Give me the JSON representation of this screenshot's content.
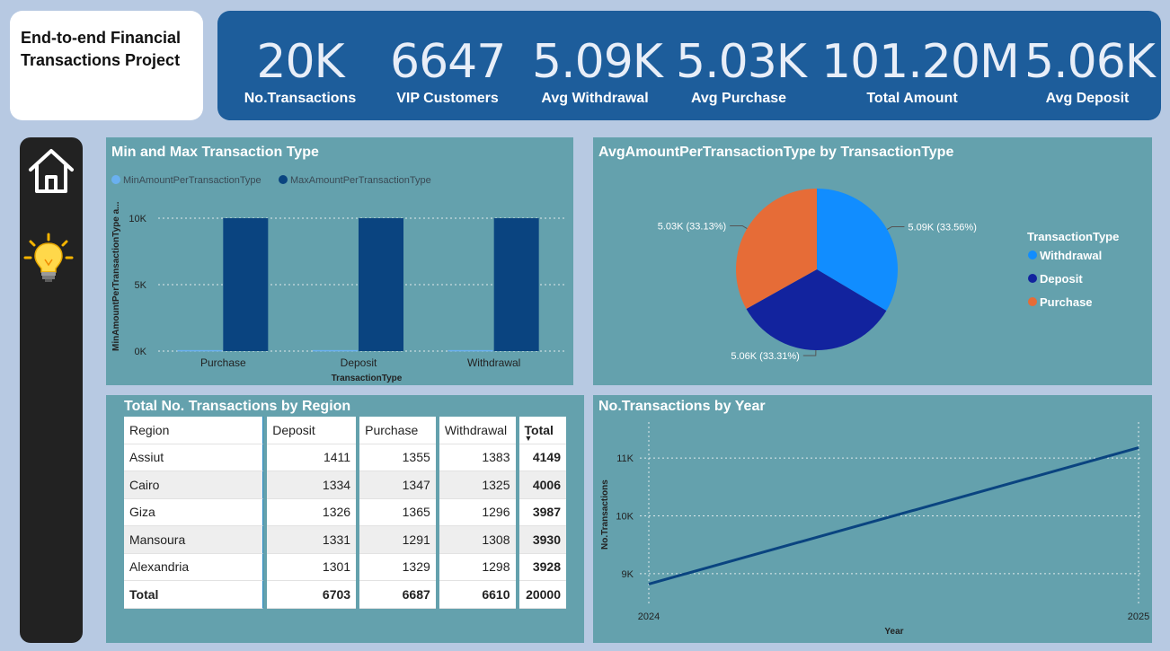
{
  "title": {
    "line1": "End-to-end Financial",
    "line2": "Transactions Project"
  },
  "kpis": [
    {
      "value": "20K",
      "label": "No.Transactions"
    },
    {
      "value": "6647",
      "label": "VIP Customers"
    },
    {
      "value": "5.09K",
      "label": "Avg Withdrawal"
    },
    {
      "value": "5.03K",
      "label": "Avg Purchase"
    },
    {
      "value": "101.20M",
      "label": "Total Amount"
    },
    {
      "value": "5.06K",
      "label": "Avg Deposit"
    }
  ],
  "sidebar": {
    "home_icon": "home-icon",
    "insight_icon": "lightbulb-icon"
  },
  "colors": {
    "kpi_bg": "#1d5d9b",
    "panel_bg": "#64a1ad",
    "max_bar": "#0a4480",
    "min_bar": "#6ab0f0",
    "withdrawal": "#118dff",
    "deposit": "#12239e",
    "purchase": "#e66c37",
    "line": "#0a4480"
  },
  "bar_panel": {
    "title": "Min and Max Transaction Type",
    "legend": [
      "MinAmountPerTransactionType",
      "MaxAmountPerTransactionType"
    ],
    "y_axis_label": "MinAmountPerTransactionType a...",
    "x_axis_label": "TransactionType"
  },
  "pie_panel": {
    "title": "AvgAmountPerTransactionType by TransactionType",
    "legend_title": "TransactionType"
  },
  "table_panel": {
    "title": "Total No. Transactions by Region",
    "columns": [
      "Region",
      "Deposit",
      "Purchase",
      "Withdrawal",
      "Total"
    ],
    "rows": [
      [
        "Assiut",
        "1411",
        "1355",
        "1383",
        "4149"
      ],
      [
        "Cairo",
        "1334",
        "1347",
        "1325",
        "4006"
      ],
      [
        "Giza",
        "1326",
        "1365",
        "1296",
        "3987"
      ],
      [
        "Mansoura",
        "1331",
        "1291",
        "1308",
        "3930"
      ],
      [
        "Alexandria",
        "1301",
        "1329",
        "1298",
        "3928"
      ]
    ],
    "footer": [
      "Total",
      "6703",
      "6687",
      "6610",
      "20000"
    ]
  },
  "line_panel": {
    "title": "No.Transactions by Year",
    "y_axis_label": "No.Transactions",
    "x_axis_label": "Year"
  },
  "chart_data": [
    {
      "type": "bar",
      "title": "Min and Max Transaction Type",
      "categories": [
        "Purchase",
        "Deposit",
        "Withdrawal"
      ],
      "series": [
        {
          "name": "MinAmountPerTransactionType",
          "values": [
            10,
            10,
            10
          ]
        },
        {
          "name": "MaxAmountPerTransactionType",
          "values": [
            10000,
            10000,
            10000
          ]
        }
      ],
      "yticks": [
        "0K",
        "5K",
        "10K"
      ],
      "ylim": [
        0,
        10000
      ],
      "xlabel": "TransactionType",
      "ylabel": "MinAmountPerTransactionType a...",
      "grid": true,
      "legend": "top-left"
    },
    {
      "type": "pie",
      "title": "AvgAmountPerTransactionType by TransactionType",
      "slices": [
        {
          "name": "Withdrawal",
          "value": 5090,
          "label": "5.09K (33.56%)"
        },
        {
          "name": "Deposit",
          "value": 5060,
          "label": "5.06K (33.31%)"
        },
        {
          "name": "Purchase",
          "value": 5030,
          "label": "5.03K (33.13%)"
        }
      ],
      "legend": "right"
    },
    {
      "type": "line",
      "title": "No.Transactions by Year",
      "x": [
        2024,
        2025
      ],
      "y": [
        8820,
        11180
      ],
      "xticks": [
        "2024",
        "2025"
      ],
      "yticks": [
        "9K",
        "10K",
        "11K"
      ],
      "ylim": [
        8500,
        11500
      ],
      "xlabel": "Year",
      "ylabel": "No.Transactions",
      "grid": true
    }
  ]
}
